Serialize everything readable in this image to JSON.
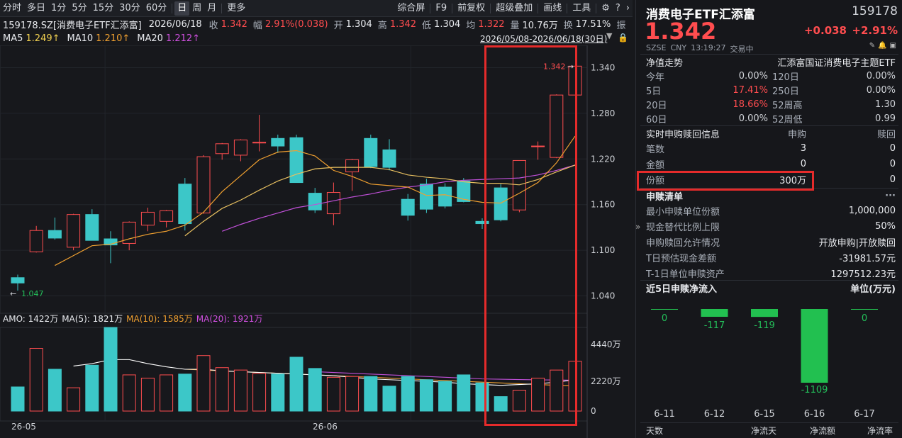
{
  "toolbar": {
    "left": [
      "分时",
      "多日",
      "1分",
      "5分",
      "15分",
      "30分",
      "60分",
      "日",
      "周",
      "月",
      "更多"
    ],
    "active": "日",
    "right": [
      "综合屏",
      "F9",
      "前复权",
      "超级叠加",
      "画线",
      "工具"
    ]
  },
  "quote": {
    "code_name": "159178.SZ[消费电子ETF汇添富]",
    "date": "2026/06/18",
    "close_label": "收",
    "close": "1.342",
    "range_label": "幅",
    "range": "2.91%(0.038)",
    "open_label": "开",
    "open": "1.304",
    "high_label": "高",
    "high": "1.342",
    "low_label": "低",
    "low": "1.304",
    "avg_label": "均",
    "avg": "1.322",
    "vol_label": "量",
    "vol": "10.76万",
    "turn_label": "换",
    "turn": "17.51%",
    "extra": "振"
  },
  "ma": {
    "ma5_label": "MA5",
    "ma5": "1.249↑",
    "ma10_label": "MA10",
    "ma10": "1.210↑",
    "ma20_label": "MA20",
    "ma20": "1.212↑"
  },
  "date_range": "2026/05/08-2026/06/18(30日)",
  "price_axis": [
    "1.340",
    "1.280",
    "1.220",
    "1.160",
    "1.100",
    "1.040"
  ],
  "price_marks": {
    "high": "1.342",
    "low": "1.047"
  },
  "vol_axis": [
    "4440万",
    "2220万",
    "0"
  ],
  "amo": {
    "amo": "AMO: 1422万",
    "ma5": "MA(5): 1821万",
    "ma10": "MA(10): 1585万",
    "ma20": "MA(20): 1921万"
  },
  "date_axis": [
    "26-05",
    "26-06"
  ],
  "chart_data": {
    "type": "candlestick",
    "ylim": [
      1.02,
      1.36
    ],
    "candles": [
      {
        "o": 1.064,
        "h": 1.068,
        "l": 1.047,
        "c": 1.057
      },
      {
        "o": 1.098,
        "h": 1.132,
        "l": 1.097,
        "c": 1.126
      },
      {
        "o": 1.126,
        "h": 1.143,
        "l": 1.114,
        "c": 1.116
      },
      {
        "o": 1.104,
        "h": 1.148,
        "l": 1.1,
        "c": 1.147
      },
      {
        "o": 1.147,
        "h": 1.154,
        "l": 1.115,
        "c": 1.113
      },
      {
        "o": 1.115,
        "h": 1.125,
        "l": 1.083,
        "c": 1.107
      },
      {
        "o": 1.109,
        "h": 1.138,
        "l": 1.1,
        "c": 1.137
      },
      {
        "o": 1.133,
        "h": 1.156,
        "l": 1.125,
        "c": 1.15
      },
      {
        "o": 1.138,
        "h": 1.153,
        "l": 1.13,
        "c": 1.152
      },
      {
        "o": 1.187,
        "h": 1.195,
        "l": 1.126,
        "c": 1.135
      },
      {
        "o": 1.149,
        "h": 1.225,
        "l": 1.148,
        "c": 1.223
      },
      {
        "o": 1.227,
        "h": 1.241,
        "l": 1.219,
        "c": 1.24
      },
      {
        "o": 1.225,
        "h": 1.246,
        "l": 1.217,
        "c": 1.245
      },
      {
        "o": 1.241,
        "h": 1.278,
        "l": 1.23,
        "c": 1.242
      },
      {
        "o": 1.247,
        "h": 1.252,
        "l": 1.228,
        "c": 1.237
      },
      {
        "o": 1.248,
        "h": 1.252,
        "l": 1.189,
        "c": 1.189
      },
      {
        "o": 1.175,
        "h": 1.182,
        "l": 1.149,
        "c": 1.153
      },
      {
        "o": 1.148,
        "h": 1.189,
        "l": 1.133,
        "c": 1.176
      },
      {
        "o": 1.203,
        "h": 1.22,
        "l": 1.178,
        "c": 1.219
      },
      {
        "o": 1.247,
        "h": 1.252,
        "l": 1.208,
        "c": 1.21
      },
      {
        "o": 1.232,
        "h": 1.246,
        "l": 1.205,
        "c": 1.209
      },
      {
        "o": 1.167,
        "h": 1.174,
        "l": 1.139,
        "c": 1.146
      },
      {
        "o": 1.187,
        "h": 1.194,
        "l": 1.149,
        "c": 1.154
      },
      {
        "o": 1.183,
        "h": 1.188,
        "l": 1.155,
        "c": 1.158
      },
      {
        "o": 1.191,
        "h": 1.195,
        "l": 1.163,
        "c": 1.164
      },
      {
        "o": 1.138,
        "h": 1.142,
        "l": 1.128,
        "c": 1.135
      },
      {
        "o": 1.182,
        "h": 1.187,
        "l": 1.138,
        "c": 1.14
      },
      {
        "o": 1.153,
        "h": 1.218,
        "l": 1.15,
        "c": 1.218
      },
      {
        "o": 1.237,
        "h": 1.243,
        "l": 1.219,
        "c": 1.237
      },
      {
        "o": 1.222,
        "h": 1.305,
        "l": 1.221,
        "c": 1.304
      },
      {
        "o": 1.304,
        "h": 1.342,
        "l": 1.304,
        "c": 1.342
      }
    ],
    "ma5": [
      1.08,
      1.093,
      1.106,
      1.108,
      1.115,
      1.121,
      1.125,
      1.133,
      1.15,
      1.177,
      1.198,
      1.219,
      1.229,
      1.231,
      1.224,
      1.205,
      1.197,
      1.187,
      1.185,
      1.183,
      1.172,
      1.173,
      1.167,
      1.163,
      1.162,
      1.175,
      1.189,
      1.215,
      1.25
    ],
    "ma10": [
      1.119,
      1.138,
      1.155,
      1.166,
      1.179,
      1.191,
      1.2,
      1.207,
      1.209,
      1.209,
      1.209,
      1.206,
      1.199,
      1.196,
      1.194,
      1.19,
      1.188,
      1.188,
      1.186,
      1.193,
      1.203,
      1.212
    ],
    "ma20": [
      1.125,
      1.134,
      1.142,
      1.149,
      1.156,
      1.16,
      1.165,
      1.17,
      1.174,
      1.179,
      1.183,
      1.186,
      1.19,
      1.192,
      1.193,
      1.194,
      1.195,
      1.199,
      1.205,
      1.212
    ],
    "volume_ylim": [
      0,
      5200
    ],
    "volume": [
      1500,
      3900,
      2600,
      1450,
      2850,
      5200,
      2250,
      2050,
      2250,
      2300,
      3450,
      2700,
      2550,
      2350,
      2300,
      3350,
      2650,
      2100,
      2150,
      2150,
      1550,
      2150,
      1950,
      1850,
      2250,
      1750,
      900,
      1300,
      2050,
      2550,
      3100,
      1422
    ],
    "volume_ma5": [
      2800,
      2950,
      3200,
      3200,
      2950,
      2750,
      2600,
      2600,
      2500,
      2450,
      2400,
      2350,
      2300,
      2250,
      2200,
      2100,
      2000,
      1950,
      1900,
      1850,
      1800,
      1700,
      1650,
      1600,
      1650,
      1700,
      1800,
      1950
    ],
    "volume_ma10": [
      2600,
      2550,
      2500,
      2450,
      2400,
      2350,
      2300,
      2250,
      2200,
      2150,
      2100,
      2050,
      2000,
      1950,
      1900,
      1850,
      1800,
      1750,
      1700,
      1650,
      1600,
      1585
    ],
    "volume_ma20": [
      2450,
      2400,
      2350,
      2300,
      2250,
      2200,
      2150,
      2100,
      2050,
      2000,
      1980,
      1960,
      1940,
      1930,
      1921
    ]
  },
  "right": {
    "title": "消费电子ETF汇添富",
    "code": "159178",
    "price": "1.342",
    "change": "+0.038",
    "pct": "+2.91%",
    "meta": [
      "SZSE",
      "CNY",
      "13:19:27",
      "交易中"
    ],
    "nav_title": "净值走势",
    "nav_index": "汇添富国证消费电子主题ETF",
    "nav_rows": [
      [
        "今年",
        "0.00%",
        "120日",
        "0.00%"
      ],
      [
        "5日",
        "17.41%",
        "250日",
        "0.00%"
      ],
      [
        "20日",
        "18.66%",
        "52周高",
        "1.30"
      ],
      [
        "60日",
        "0.00%",
        "52周低",
        "0.99"
      ]
    ],
    "sub_title": "实时申购赎回信息",
    "sub_col1": "申购",
    "sub_col2": "赎回",
    "sub_rows": [
      [
        "笔数",
        "3",
        "0"
      ],
      [
        "金额",
        "0",
        "0"
      ],
      [
        "份额",
        "300万",
        "0"
      ]
    ],
    "list_title": "申赎清单",
    "list_rows": [
      [
        "最小申赎单位份额",
        "1,000,000"
      ],
      [
        "现金替代比例上限",
        "50%"
      ],
      [
        "申购赎回允许情况",
        "开放申购|开放赎回"
      ],
      [
        "T日预估现金差额",
        "-31981.57元"
      ],
      [
        "T-1日单位申赎资产",
        "1297512.23元"
      ]
    ],
    "flow_title": "近5日申赎净流入",
    "flow_unit": "单位(万元)",
    "flow": [
      {
        "date": "6-11",
        "value": 0
      },
      {
        "date": "6-12",
        "value": -117
      },
      {
        "date": "6-15",
        "value": -119
      },
      {
        "date": "6-16",
        "value": -1109
      },
      {
        "date": "6-17",
        "value": 0
      }
    ],
    "footer": [
      "天数",
      "净流天",
      "净流额",
      "净流率"
    ]
  },
  "colors": {
    "up": "#ff4d4f",
    "down": "#3cc7c8",
    "ma5": "#ffffff",
    "ma10": "#f0a030",
    "ma20": "#d050e0",
    "flow": "#22c050",
    "highlight": "#e52b2b"
  }
}
